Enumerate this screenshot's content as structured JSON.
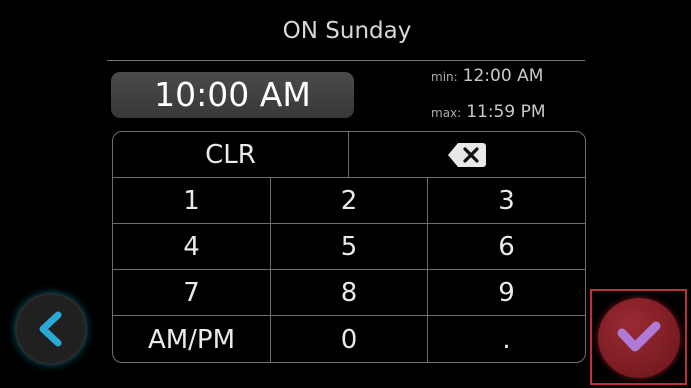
{
  "header": {
    "title": "ON Sunday"
  },
  "entry": {
    "value": "10:00 AM",
    "min_label": "min:",
    "min_value": "12:00 AM",
    "max_label": "max:",
    "max_value": "11:59 PM"
  },
  "keypad": {
    "clear": "CLR",
    "backspace_icon": "backspace-icon",
    "keys": [
      "1",
      "2",
      "3",
      "4",
      "5",
      "6",
      "7",
      "8",
      "9",
      "AM/PM",
      "0",
      "."
    ]
  },
  "nav": {
    "back_icon": "chevron-left-icon",
    "confirm_icon": "checkmark-icon",
    "accent_back": "#2aa9d6",
    "accent_confirm": "#b07ad6"
  }
}
